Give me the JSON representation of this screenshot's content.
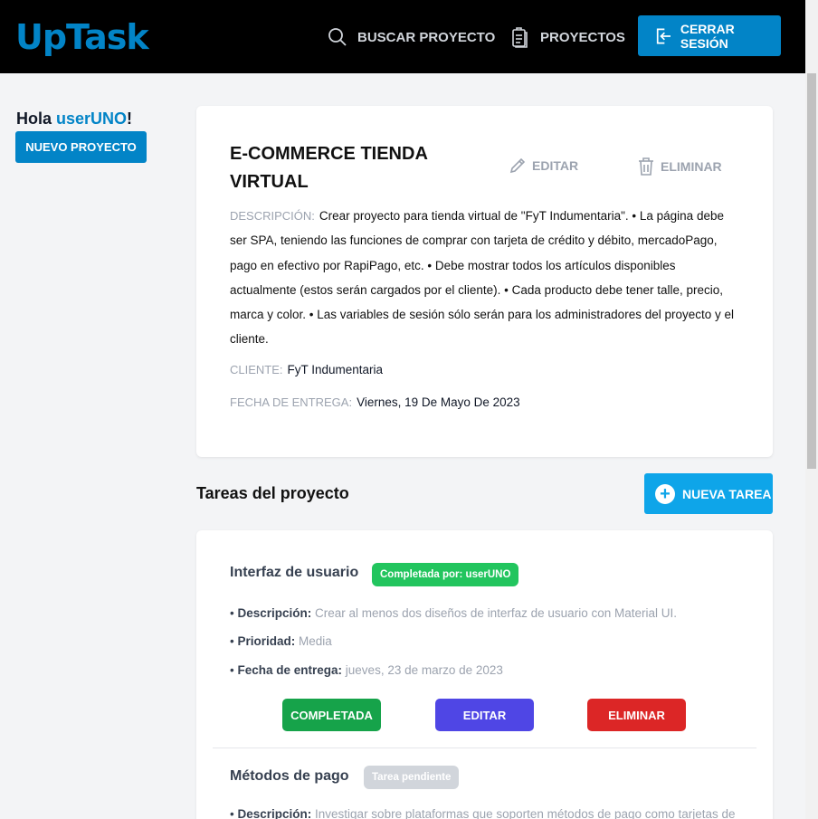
{
  "header": {
    "logo": "UpTask",
    "search_label": "BUSCAR PROYECTO",
    "projects_label": "PROYECTOS",
    "logout_label": "CERRAR SESIÓN"
  },
  "sidebar": {
    "greeting_prefix": "Hola ",
    "username": "userUNO",
    "greeting_suffix": "!",
    "new_project_label": "NUEVO PROYECTO"
  },
  "project": {
    "title": "E-COMMERCE TIENDA VIRTUAL",
    "edit_label": "EDITAR",
    "delete_label": "ELIMINAR",
    "description_label": "DESCRIPCIÓN:",
    "description": "Crear proyecto para tienda virtual de \"FyT Indumentaria\". • La página debe ser SPA, teniendo las funciones de comprar con tarjeta de crédito y débito, mercadoPago, pago en efectivo por RapiPago, etc. • Debe mostrar todos los artículos disponibles actualmente (estos serán cargados por el cliente). • Cada producto debe tener talle, precio, marca y color. • Las variables de sesión sólo serán para los administradores del proyecto y el cliente.",
    "client_label": "CLIENTE:",
    "client": "FyT Indumentaria",
    "due_label": "FECHA DE ENTREGA:",
    "due": "Viernes, 19 De Mayo De 2023"
  },
  "tasks_section": {
    "title": "Tareas del proyecto",
    "new_task_label": "NUEVA TAREA"
  },
  "tasks": [
    {
      "name": "Interfaz de usuario",
      "badge": "Completada por: userUNO",
      "desc_label": "Descripción:",
      "desc": "Crear al menos dos diseños de interfaz de usuario con Material UI.",
      "priority_label": "Prioridad:",
      "priority": "Media",
      "due_label": "Fecha de entrega:",
      "due": "jueves, 23 de marzo de 2023",
      "complete_label": "COMPLETADA",
      "edit_label": "EDITAR",
      "delete_label": "ELIMINAR"
    },
    {
      "name": "Métodos de pago",
      "badge": "Tarea pendiente",
      "desc_label": "Descripción:",
      "desc": "Investigar sobre plataformas que soporten métodos de pago como tarjetas de"
    }
  ],
  "colors": {
    "brand": "#0284c7",
    "header_bg": "#000000",
    "new_task": "#0ea5e9",
    "complete": "#16a34a",
    "edit": "#4f46e5",
    "delete": "#dc2626",
    "badge_done": "#22c55e",
    "badge_pending": "#d1d5db"
  }
}
